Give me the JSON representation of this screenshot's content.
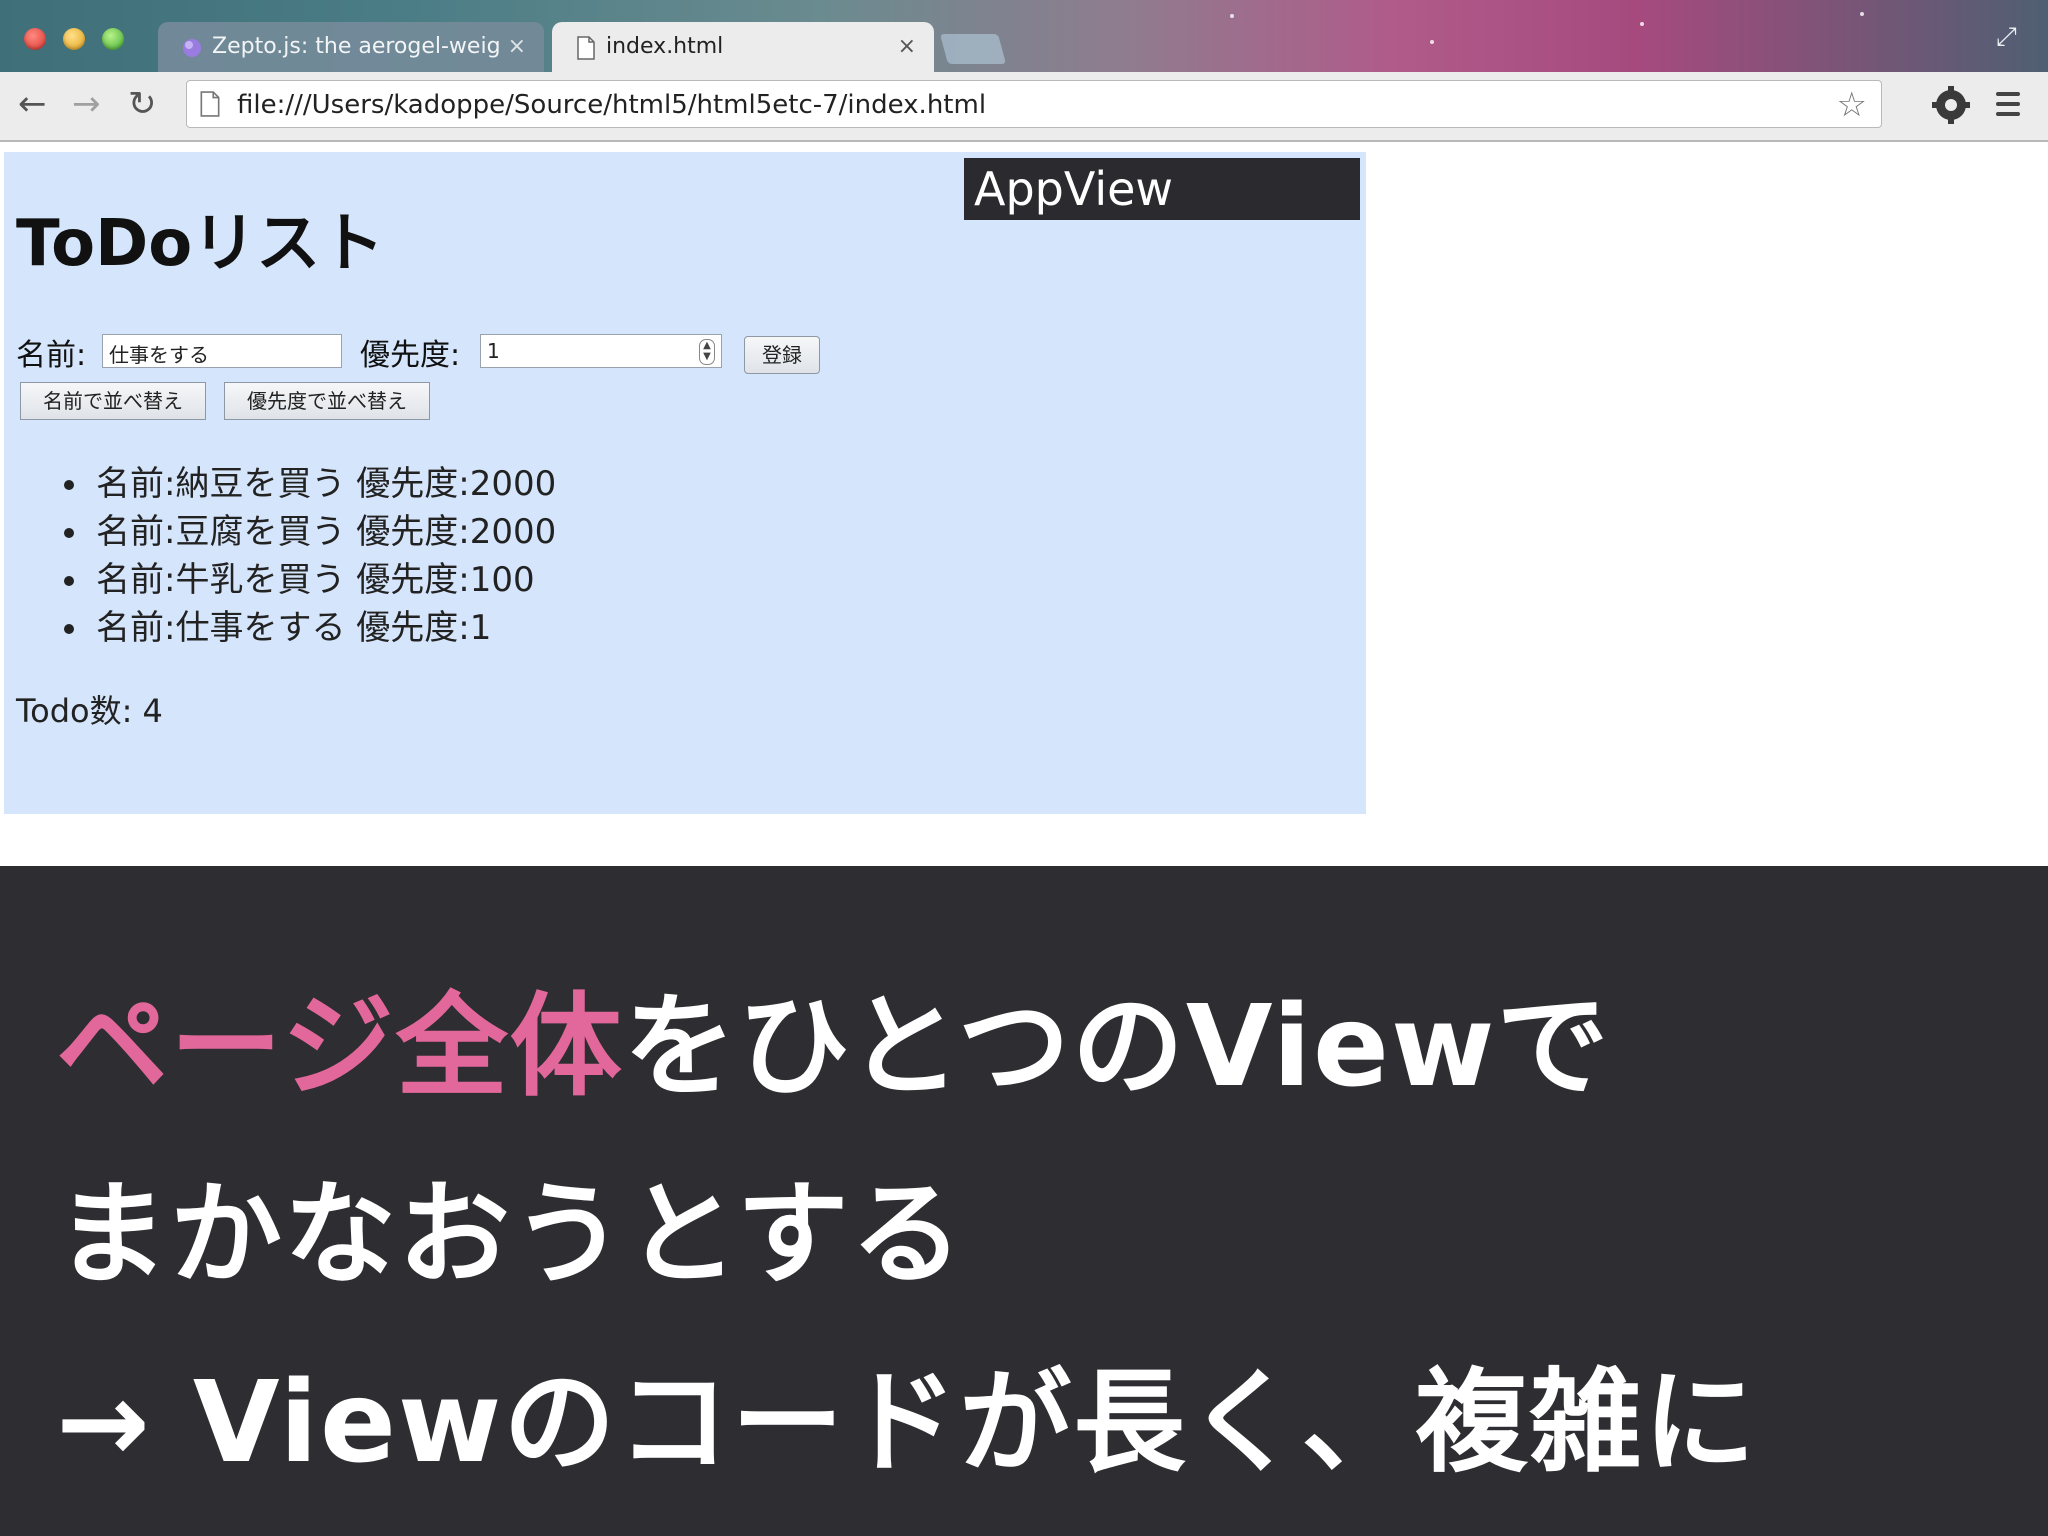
{
  "browser": {
    "tabs": [
      {
        "title": "Zepto.js: the aerogel-weig",
        "close": "×",
        "active": false
      },
      {
        "title": "index.html",
        "close": "×",
        "active": true
      }
    ],
    "url": "file:///Users/kadoppe/Source/html5/html5etc-7/index.html",
    "icons": {
      "back": "arrow-left-icon",
      "forward": "arrow-right-icon",
      "reload": "reload-icon",
      "bookmark": "star-icon",
      "settings": "wrench-icon",
      "menu": "hamburger-icon"
    },
    "glyphs": {
      "back": "←",
      "forward": "→",
      "reload": "↻",
      "star": "☆",
      "fullscreen": "⤢"
    }
  },
  "page": {
    "appview_tag": "AppView",
    "title": "ToDoリスト",
    "form": {
      "name_label": "名前:",
      "name_value": "仕事をする",
      "priority_label": "優先度:",
      "priority_value": "1",
      "register_button": "登録",
      "sort_by_name_button": "名前で並べ替え",
      "sort_by_priority_button": "優先度で並べ替え"
    },
    "todos": [
      "名前:納豆を買う 優先度:2000",
      "名前:豆腐を買う 優先度:2000",
      "名前:牛乳を買う 優先度:100",
      "名前:仕事をする 優先度:1"
    ],
    "todo_count": "Todo数: 4"
  },
  "caption": {
    "line1_accent": "ページ全体",
    "line1_rest": "をひとつのViewで",
    "line2": "まかなおうとする",
    "line3": "→ Viewのコードが長く、複雑に",
    "accent_color": "#e2679b",
    "background_color": "#2e2d31"
  }
}
